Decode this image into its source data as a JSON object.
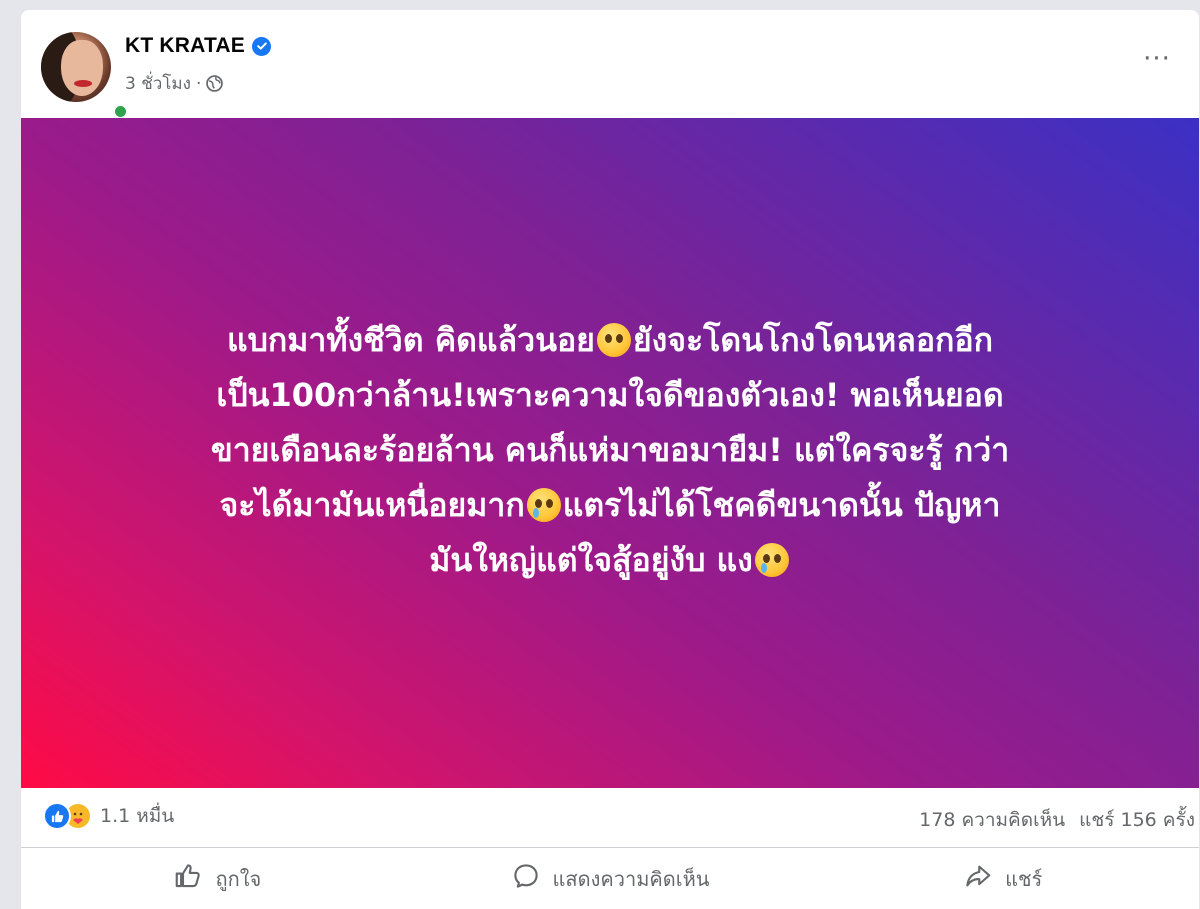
{
  "post": {
    "author": "KT KRATAE",
    "time": "3 ชั่วโมง",
    "separator": "·",
    "more": "···",
    "text_lines": [
      "แบกมาทั้งชีวิต คิดแล้วนอย",
      "ยังจะโดนโกงโดนหลอกอีก",
      "เป็น100กว่าล้าน!เพราะความใจดีของตัวเอง! พอเห็นยอด",
      "ขายเดือนละร้อยล้าน คนก็แห่มาขอมายืม! แต่ใครจะรู้ กว่า",
      "จะได้มามันเหนื่อยมาก",
      "แตรไม่ได้โชคดีขนาดนั้น ปัญหา",
      "มันใหญ่แต่ใจสู้อยู่งับ แง"
    ],
    "background_colors": [
      "#ff0a45",
      "#3b30c4"
    ]
  },
  "stats": {
    "reactions": "1.1 หมื่น",
    "comments": "178 ความคิดเห็น",
    "shares": "แชร์ 156 ครั้ง"
  },
  "actions": {
    "like": "ถูกใจ",
    "comment": "แสดงความคิดเห็น",
    "share": "แชร์"
  },
  "icons": [
    "verified-icon",
    "globe-icon",
    "like-reaction-icon",
    "care-reaction-icon",
    "thumbs-up-icon",
    "comment-bubble-icon",
    "share-arrow-icon",
    "pleading-face-emoji",
    "crying-face-emoji",
    "loudly-crying-face-emoji"
  ]
}
